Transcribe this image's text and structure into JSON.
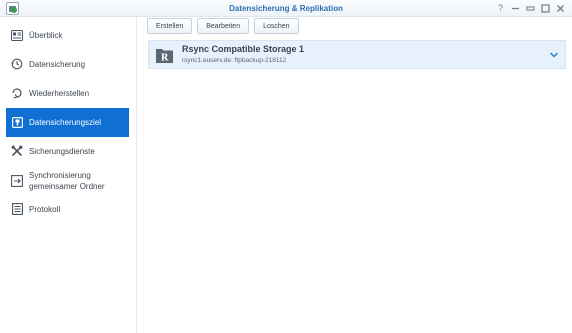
{
  "window": {
    "title": "Datensicherung & Replikation",
    "controls": [
      "help-icon",
      "pin-icon",
      "minimize-icon",
      "maximize-icon",
      "close-icon"
    ]
  },
  "sidebar": {
    "items": [
      {
        "label": "Überblick",
        "icon": "overview-icon",
        "active": false
      },
      {
        "label": "Datensicherung",
        "icon": "history-icon",
        "active": false
      },
      {
        "label": "Wiederherstellen",
        "icon": "restore-icon",
        "active": false
      },
      {
        "label": "Datensicherungsziel",
        "icon": "target-icon",
        "active": true
      },
      {
        "label": "Sicherungsdienste",
        "icon": "tools-icon",
        "active": false
      },
      {
        "label": "Synchronisierung gemeinsamer Ordner",
        "icon": "sync-icon",
        "active": false
      },
      {
        "label": "Protokoll",
        "icon": "log-icon",
        "active": false
      }
    ]
  },
  "toolbar": {
    "create_label": "Erstellen",
    "edit_label": "Bearbeiten",
    "delete_label": "Loschen"
  },
  "targets": [
    {
      "name": "Rsync Compatible Storage 1",
      "detail": "rsync1.euserv.de: ftpbackup-218112",
      "icon": "folder-r-icon"
    }
  ],
  "colors": {
    "accent": "#0f6fd3",
    "title_text": "#2f6fb3",
    "selected_row_bg": "#e6f1fb"
  }
}
